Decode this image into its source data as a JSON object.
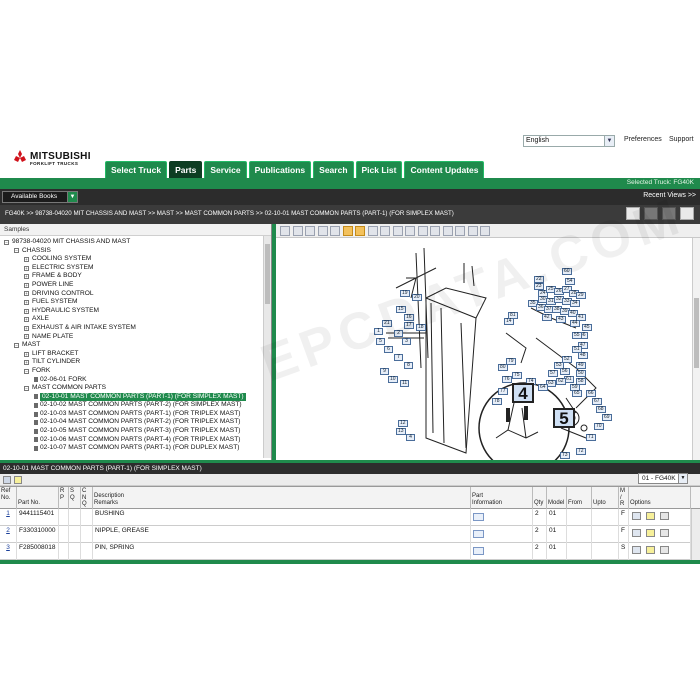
{
  "header": {
    "brand": "MITSUBISHI",
    "brand_sub": "FORKLIFT TRUCKS",
    "language": "English",
    "links": {
      "preferences": "Preferences",
      "support": "Support"
    }
  },
  "tabs": [
    {
      "label": "Select Truck",
      "active": false
    },
    {
      "label": "Parts",
      "active": true
    },
    {
      "label": "Service",
      "active": false
    },
    {
      "label": "Publications",
      "active": false
    },
    {
      "label": "Search",
      "active": false
    },
    {
      "label": "Pick List",
      "active": false
    },
    {
      "label": "Content Updates",
      "active": false
    }
  ],
  "status": {
    "selected_truck": "Selected Truck:  FG40K"
  },
  "books": {
    "label": "Available Books",
    "recent_views": "Recent Views >>"
  },
  "breadcrumb": "FG40K >> 98738-04020 MIT CHASSIS AND MAST >> MAST >> MAST COMMON PARTS >> 02-10-01 MAST COMMON PARTS (PART-1) (FOR SIMPLEX MAST)",
  "tree": {
    "header": "Samples",
    "items": [
      {
        "label": "98738-04020 MIT CHASSIS AND MAST",
        "level": 0,
        "kind": "minus"
      },
      {
        "label": "CHASSIS",
        "level": 1,
        "kind": "minus"
      },
      {
        "label": "COOLING SYSTEM",
        "level": 2,
        "kind": "plus"
      },
      {
        "label": "ELECTRIC SYSTEM",
        "level": 2,
        "kind": "plus"
      },
      {
        "label": "FRAME & BODY",
        "level": 2,
        "kind": "plus"
      },
      {
        "label": "POWER LINE",
        "level": 2,
        "kind": "plus"
      },
      {
        "label": "DRIVING CONTROL",
        "level": 2,
        "kind": "plus"
      },
      {
        "label": "FUEL SYSTEM",
        "level": 2,
        "kind": "plus"
      },
      {
        "label": "HYDRAULIC SYSTEM",
        "level": 2,
        "kind": "plus"
      },
      {
        "label": "AXLE",
        "level": 2,
        "kind": "plus"
      },
      {
        "label": "EXHAUST & AIR INTAKE SYSTEM",
        "level": 2,
        "kind": "plus"
      },
      {
        "label": "NAME PLATE",
        "level": 2,
        "kind": "plus"
      },
      {
        "label": "MAST",
        "level": 1,
        "kind": "minus"
      },
      {
        "label": "LIFT BRACKET",
        "level": 2,
        "kind": "plus"
      },
      {
        "label": "TILT CYLINDER",
        "level": 2,
        "kind": "plus"
      },
      {
        "label": "FORK",
        "level": 2,
        "kind": "minus"
      },
      {
        "label": "02-06-01 FORK",
        "level": 3,
        "kind": "page"
      },
      {
        "label": "MAST COMMON PARTS",
        "level": 2,
        "kind": "minus"
      },
      {
        "label": "02-10-01 MAST COMMON PARTS (PART-1) (FOR SIMPLEX MAST)",
        "level": 3,
        "kind": "page",
        "selected": true
      },
      {
        "label": "02-10-02 MAST COMMON PARTS (PART-2) (FOR SIMPLEX MAST)",
        "level": 3,
        "kind": "page"
      },
      {
        "label": "02-10-03 MAST COMMON PARTS (PART-1) (FOR TRIPLEX MAST)",
        "level": 3,
        "kind": "page"
      },
      {
        "label": "02-10-04 MAST COMMON PARTS (PART-2) (FOR TRIPLEX MAST)",
        "level": 3,
        "kind": "page"
      },
      {
        "label": "02-10-05 MAST COMMON PARTS (PART-3) (FOR TRIPLEX MAST)",
        "level": 3,
        "kind": "page"
      },
      {
        "label": "02-10-06 MAST COMMON PARTS (PART-4) (FOR TRIPLEX MAST)",
        "level": 3,
        "kind": "page"
      },
      {
        "label": "02-10-07 MAST COMMON PARTS (PART-1) (FOR DUPLEX MAST)",
        "level": 3,
        "kind": "page"
      }
    ]
  },
  "drawing": {
    "callouts": [
      "60",
      "54",
      "22",
      "23",
      "24",
      "25",
      "26",
      "27",
      "28",
      "29",
      "30",
      "31",
      "32",
      "33",
      "34",
      "35",
      "36",
      "37",
      "38",
      "39",
      "40",
      "41",
      "42",
      "43",
      "44",
      "45",
      "46",
      "47",
      "48",
      "49",
      "50",
      "51",
      "52",
      "53",
      "55",
      "56",
      "57",
      "58",
      "59",
      "61",
      "62",
      "63",
      "64",
      "65",
      "66",
      "67",
      "68",
      "69",
      "70",
      "71",
      "72",
      "73",
      "74",
      "75",
      "76",
      "77",
      "78",
      "79",
      "80",
      "81",
      "14",
      "15",
      "16",
      "17",
      "18",
      "19",
      "20",
      "21",
      "1",
      "2",
      "3",
      "5",
      "6",
      "7",
      "8",
      "9",
      "10",
      "11",
      "12",
      "13",
      "4"
    ],
    "big_callouts": [
      "4",
      "5"
    ]
  },
  "parts": {
    "title": "02-10-01 MAST COMMON PARTS (PART-1) (FOR SIMPLEX MAST)",
    "model_select": "01 - FG40K",
    "columns": {
      "ref": "Ref\nNo.",
      "part_no": "Part No.",
      "r": "R\nP",
      "s": "S\nQ",
      "c": "C\nN\nQ",
      "desc": "Description\nRemarks",
      "info": "Part\nInformation",
      "qty": "Qty",
      "model": "Model",
      "from": "From",
      "upto": "Upto",
      "mr": "M\n/\nR",
      "options": "Options"
    },
    "rows": [
      {
        "ref": "1",
        "part_no": "9441115401",
        "desc": "BUSHING",
        "qty": "2",
        "model": "01",
        "mr": "F"
      },
      {
        "ref": "2",
        "part_no": "F330310000",
        "desc": "NIPPLE, GREASE",
        "qty": "2",
        "model": "01",
        "mr": "F"
      },
      {
        "ref": "3",
        "part_no": "F285008018",
        "desc": "PIN, SPRING",
        "qty": "2",
        "model": "01",
        "mr": "S"
      }
    ]
  },
  "colors": {
    "brand_green": "#1f8a4c",
    "active_tab": "#0d3d22",
    "dark_bar": "#2c2c2c",
    "selection": "#1f8a4c"
  },
  "watermark": "EPCDATA.COM"
}
